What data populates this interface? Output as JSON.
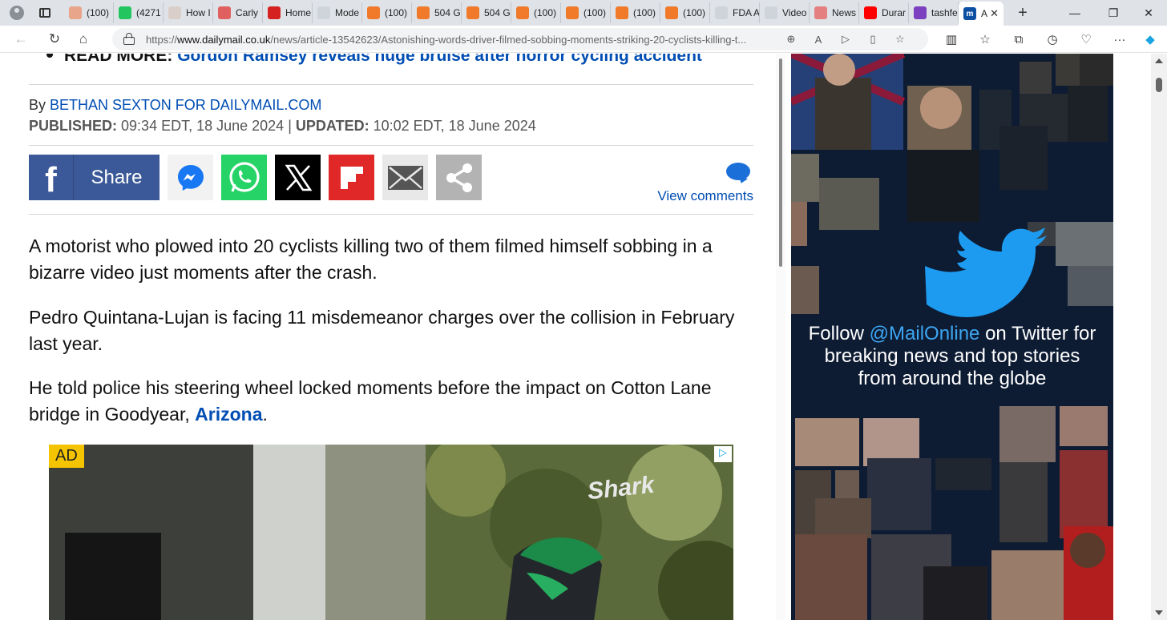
{
  "browser": {
    "tabs": [
      {
        "label": "(100)",
        "color": "#e9a58a"
      },
      {
        "label": "(4271",
        "color": "#22c55e"
      },
      {
        "label": "How I",
        "color": "#d9cfc8"
      },
      {
        "label": "Carly",
        "color": "#e06060"
      },
      {
        "label": "Home",
        "color": "#d62121"
      },
      {
        "label": "Mode",
        "color": "#cfd4da"
      },
      {
        "label": "(100)",
        "color": "#f07a2a"
      },
      {
        "label": "504 G",
        "color": "#f07a2a"
      },
      {
        "label": "504 G",
        "color": "#f07a2a"
      },
      {
        "label": "(100)",
        "color": "#f07a2a"
      },
      {
        "label": "(100)",
        "color": "#f07a2a"
      },
      {
        "label": "(100)",
        "color": "#f07a2a"
      },
      {
        "label": "(100)",
        "color": "#f07a2a"
      },
      {
        "label": "FDA A",
        "color": "#cfd4da"
      },
      {
        "label": "Video",
        "color": "#cfd4da"
      },
      {
        "label": "News",
        "color": "#e58080"
      },
      {
        "label": "Durar",
        "color": "#ff0000"
      },
      {
        "label": "tashfe",
        "color": "#7b3fbf"
      }
    ],
    "active_tab": {
      "label": "A",
      "favicon": "m",
      "color": "#0d4fa3"
    },
    "url_prefix": "https://",
    "url_domain": "www.dailymail.co.uk",
    "url_path": "/news/article-13542623/Astonishing-words-driver-filmed-sobbing-moments-striking-20-cyclists-killing-t..."
  },
  "article": {
    "read_more_label": "READ MORE:",
    "read_more_link": "Gordon Ramsey reveals huge bruise after horror cycling accident",
    "by": "By",
    "author": "BETHAN SEXTON FOR DAILYMAIL.COM",
    "published_label": "PUBLISHED:",
    "published_value": "09:34 EDT, 18 June 2024",
    "separator": "|",
    "updated_label": "UPDATED:",
    "updated_value": "10:02 EDT, 18 June 2024",
    "share_label": "Share",
    "view_comments": "View comments",
    "paragraphs": [
      "A motorist who plowed into 20 cyclists killing two of them filmed himself sobbing in a bizarre video just moments after the crash.",
      "Pedro Quintana-Lujan is facing 11 misdemeanor charges over the collision in February last year."
    ],
    "para3_text": "He told police his steering wheel locked moments before the impact on Cotton Lane bridge in Goodyear,",
    "para3_link": "Arizona",
    "para3_end": "."
  },
  "ad": {
    "badge": "AD",
    "overlay_text": "Shark"
  },
  "twitter_promo": {
    "line1_pre": "Follow",
    "handle": "@MailOnline",
    "line1_post": "on Twitter for",
    "line2": "breaking news and top stories",
    "line3": "from around the globe"
  },
  "colors": {
    "link_blue": "#004db3",
    "facebook": "#3b5998",
    "whatsapp": "#25d366",
    "flipboard": "#e12828",
    "twitter_blue": "#1d9bf0"
  }
}
